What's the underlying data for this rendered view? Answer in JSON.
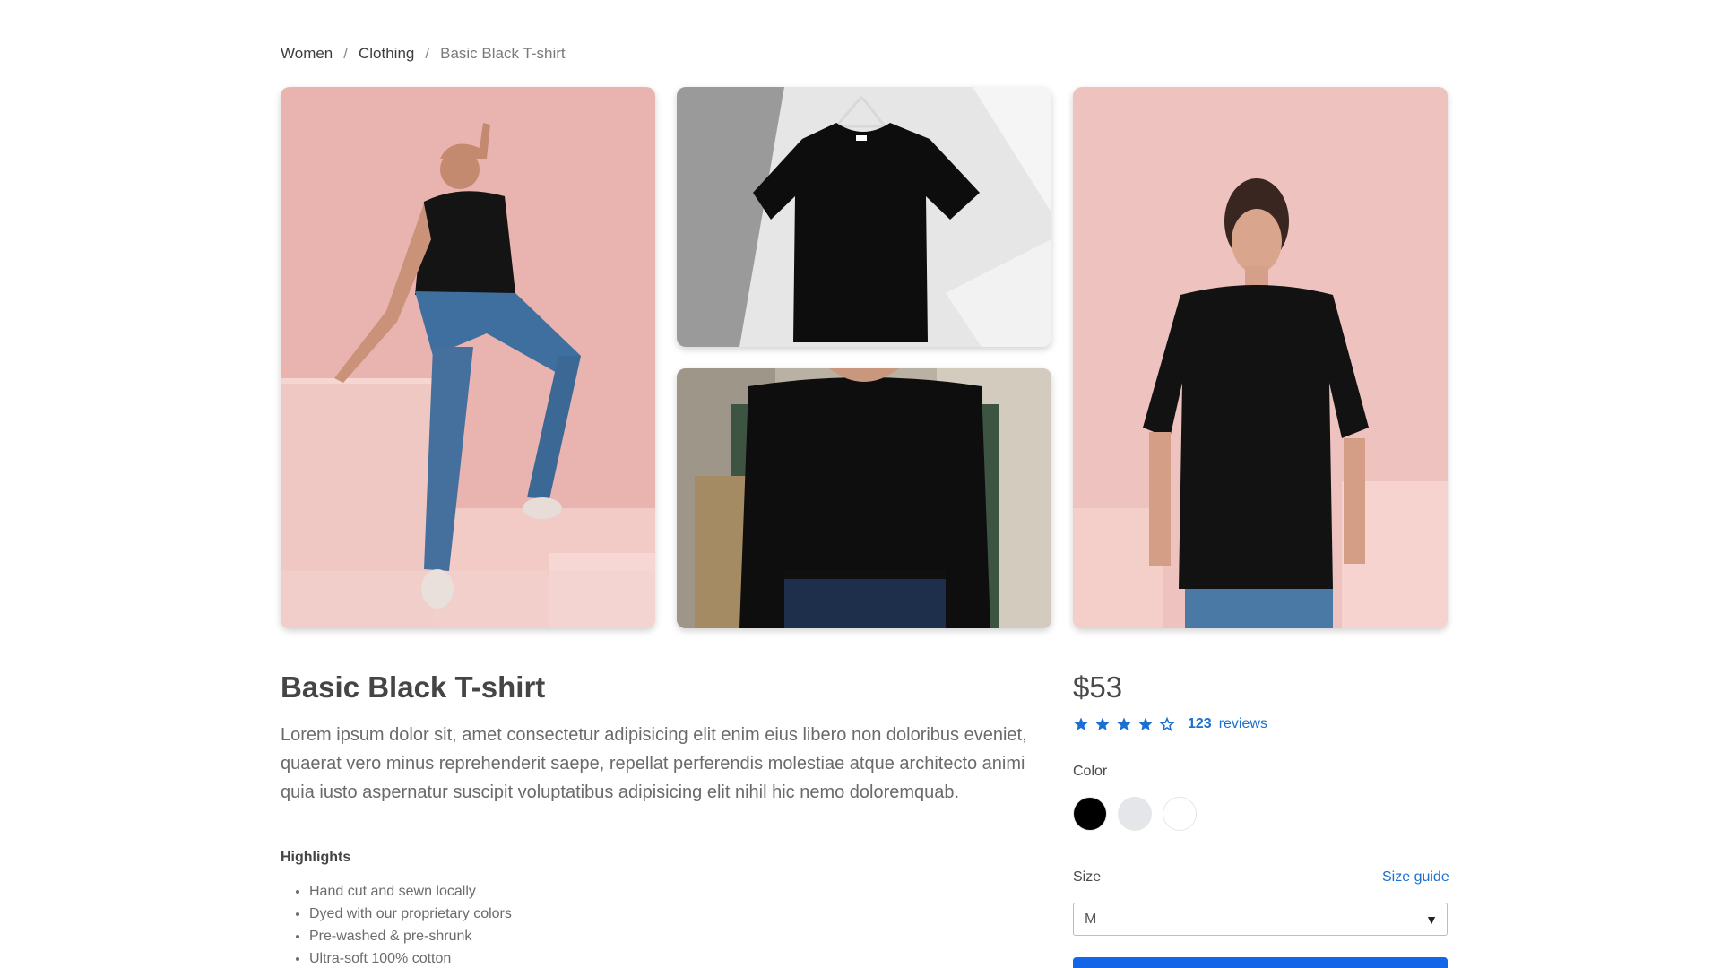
{
  "breadcrumb": {
    "items": [
      "Women",
      "Clothing"
    ],
    "separator": "/",
    "current": "Basic Black T-shirt"
  },
  "product": {
    "title": "Basic Black T-shirt",
    "description": "Lorem ipsum dolor sit, amet consectetur adipisicing elit enim eius libero non doloribus eveniet, quaerat vero minus reprehenderit saepe, repellat perferendis molestiae atque architecto animi quia iusto aspernatur suscipit voluptatibus adipisicing elit nihil hic nemo doloremquab.",
    "highlights_label": "Highlights",
    "highlights": [
      "Hand cut and sewn locally",
      "Dyed with our proprietary colors",
      "Pre-washed & pre-shrunk",
      "Ultra-soft 100% cotton"
    ],
    "price": "$53",
    "rating": {
      "value": 4,
      "max": 5,
      "count": "123",
      "reviews_word": "reviews"
    },
    "color_label": "Color",
    "colors": [
      "#000000",
      "#e5e6ea",
      "#ffffff"
    ],
    "size_label": "Size",
    "size_guide": "Size guide",
    "selected_size": "M"
  },
  "theme": {
    "accent": "#1a6fd1",
    "button": "#1565e8"
  },
  "icons": {
    "star_filled": "star-filled-icon",
    "star_empty": "star-outline-icon",
    "select_arrow": "chevron-down-icon"
  }
}
